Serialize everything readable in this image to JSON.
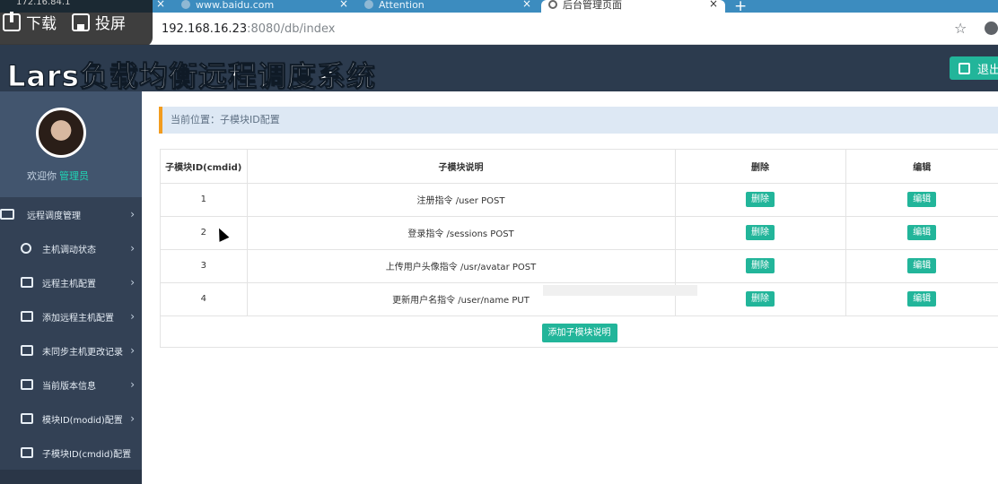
{
  "browser": {
    "tabs": [
      {
        "label": "",
        "close": "×"
      },
      {
        "label": "www.baidu.com",
        "close": "×"
      },
      {
        "label": "Attention",
        "close": "×"
      },
      {
        "label": "后台管理页面",
        "close": "×"
      }
    ],
    "new_tab": "+",
    "url_host": "192.168.16.23",
    "url_path": ":8080/db/index",
    "star": "☆"
  },
  "overlay": {
    "ip": "172.16.84.1",
    "download_label": "下载",
    "cast_label": "投屏"
  },
  "header": {
    "title": "Lars负载均衡远程调度系统",
    "logout_label": "退出"
  },
  "sidebar": {
    "welcome": "欢迎你",
    "role": "管理员",
    "items": [
      {
        "label": "远程调度管理",
        "icon": "card-icon"
      },
      {
        "label": "主机调动状态",
        "icon": "search-icon"
      },
      {
        "label": "远程主机配置",
        "icon": "grid-icon"
      },
      {
        "label": "添加远程主机配置",
        "icon": "edit-icon"
      },
      {
        "label": "未同步主机更改记录",
        "icon": "list-icon"
      },
      {
        "label": "当前版本信息",
        "icon": "list-icon"
      },
      {
        "label": "模块ID(modid)配置",
        "icon": "edit-icon"
      },
      {
        "label": "子模块ID(cmdid)配置",
        "icon": "edit-icon"
      }
    ],
    "chevron": "›"
  },
  "main": {
    "breadcrumb": "当前位置：子模块ID配置",
    "table": {
      "headers": [
        "子模块ID(cmdid)",
        "子模块说明",
        "删除",
        "编辑"
      ],
      "rows": [
        {
          "id": "1",
          "desc": "注册指令 /user POST"
        },
        {
          "id": "2",
          "desc": "登录指令 /sessions POST"
        },
        {
          "id": "3",
          "desc": "上传用户头像指令 /usr/avatar POST"
        },
        {
          "id": "4",
          "desc": "更新用户名指令 /user/name PUT"
        }
      ],
      "delete_label": "删除",
      "edit_label": "编辑"
    },
    "add_button": "添加子模块说明"
  }
}
